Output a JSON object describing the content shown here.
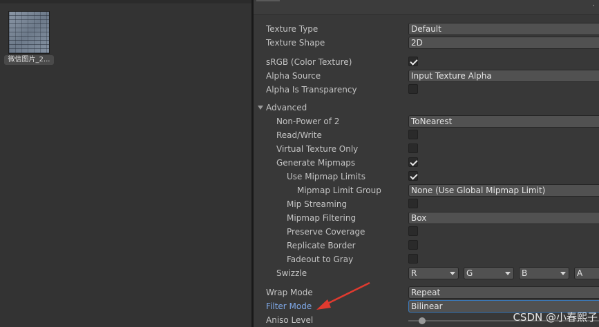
{
  "project": {
    "asset_label": "微信图片_2..."
  },
  "inspector": {
    "texture_type": {
      "label": "Texture Type",
      "value": "Default"
    },
    "texture_shape": {
      "label": "Texture Shape",
      "value": "2D"
    },
    "srgb": {
      "label": "sRGB (Color Texture)",
      "checked": true
    },
    "alpha_source": {
      "label": "Alpha Source",
      "value": "Input Texture Alpha"
    },
    "alpha_is_transparency": {
      "label": "Alpha Is Transparency",
      "checked": false
    },
    "advanced": {
      "label": "Advanced",
      "expanded": true
    },
    "non_power_of_2": {
      "label": "Non-Power of 2",
      "value": "ToNearest"
    },
    "read_write": {
      "label": "Read/Write",
      "checked": false
    },
    "virtual_texture_only": {
      "label": "Virtual Texture Only",
      "checked": false
    },
    "generate_mipmaps": {
      "label": "Generate Mipmaps",
      "checked": true
    },
    "use_mipmap_limits": {
      "label": "Use Mipmap Limits",
      "checked": true
    },
    "mipmap_limit_group": {
      "label": "Mipmap Limit Group",
      "value": "None (Use Global Mipmap Limit)"
    },
    "mip_streaming": {
      "label": "Mip Streaming",
      "checked": false
    },
    "mipmap_filtering": {
      "label": "Mipmap Filtering",
      "value": "Box"
    },
    "preserve_coverage": {
      "label": "Preserve Coverage",
      "checked": false
    },
    "replicate_border": {
      "label": "Replicate Border",
      "checked": false
    },
    "fadeout_to_gray": {
      "label": "Fadeout to Gray",
      "checked": false
    },
    "swizzle": {
      "label": "Swizzle",
      "values": [
        "R",
        "G",
        "B",
        "A"
      ]
    },
    "wrap_mode": {
      "label": "Wrap Mode",
      "value": "Repeat"
    },
    "filter_mode": {
      "label": "Filter Mode",
      "value": "Bilinear"
    },
    "aniso_level": {
      "label": "Aniso Level",
      "value": 1
    }
  },
  "colors": {
    "highlight_label": "#7fa9e8",
    "annotation_arrow": "#e03a2f"
  },
  "watermark": "CSDN @小春熙子"
}
